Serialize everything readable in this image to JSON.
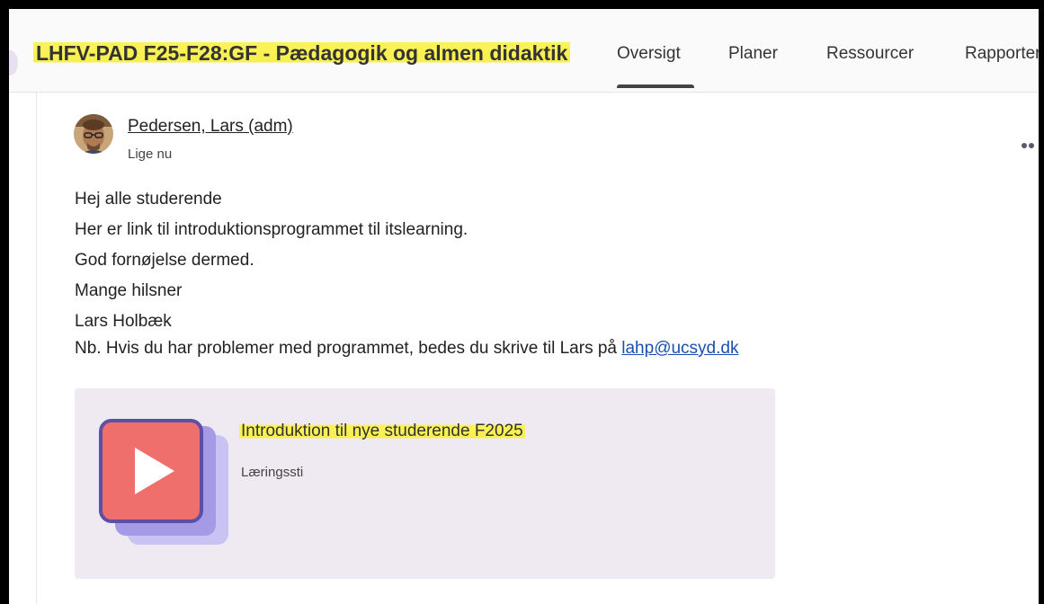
{
  "course": {
    "title": "LHFV-PAD F25-F28:GF - Pædagogik og almen didaktik",
    "tabs": [
      {
        "label": "Oversigt",
        "active": true
      },
      {
        "label": "Planer",
        "active": false
      },
      {
        "label": "Ressourcer",
        "active": false
      },
      {
        "label": "Rapporter",
        "active": false
      }
    ]
  },
  "post": {
    "author": "Pedersen, Lars (adm)",
    "time": "Lige nu",
    "lines": [
      "Hej alle studerende",
      "Her er link til introduktionsprogrammet til itslearning.",
      "God fornøjelse dermed.",
      "Mange hilsner",
      "Lars Holbæk"
    ],
    "last_line_prefix": "Nb. Hvis du har problemer med programmet, bedes du skrive til Lars på ",
    "email": "lahp@ucsyd.dk",
    "more_icon": "more-dots-icon"
  },
  "card": {
    "title": "Introduktion til nye studerende F2025",
    "subtitle": "Læringssti",
    "icon": "play-icon"
  },
  "colors": {
    "highlight": "#f7ef4f",
    "card_bg": "#efeaf1",
    "play_red": "#ef6f6c",
    "icon_purple": "#5b4fa8",
    "link": "#1a4fb0"
  }
}
